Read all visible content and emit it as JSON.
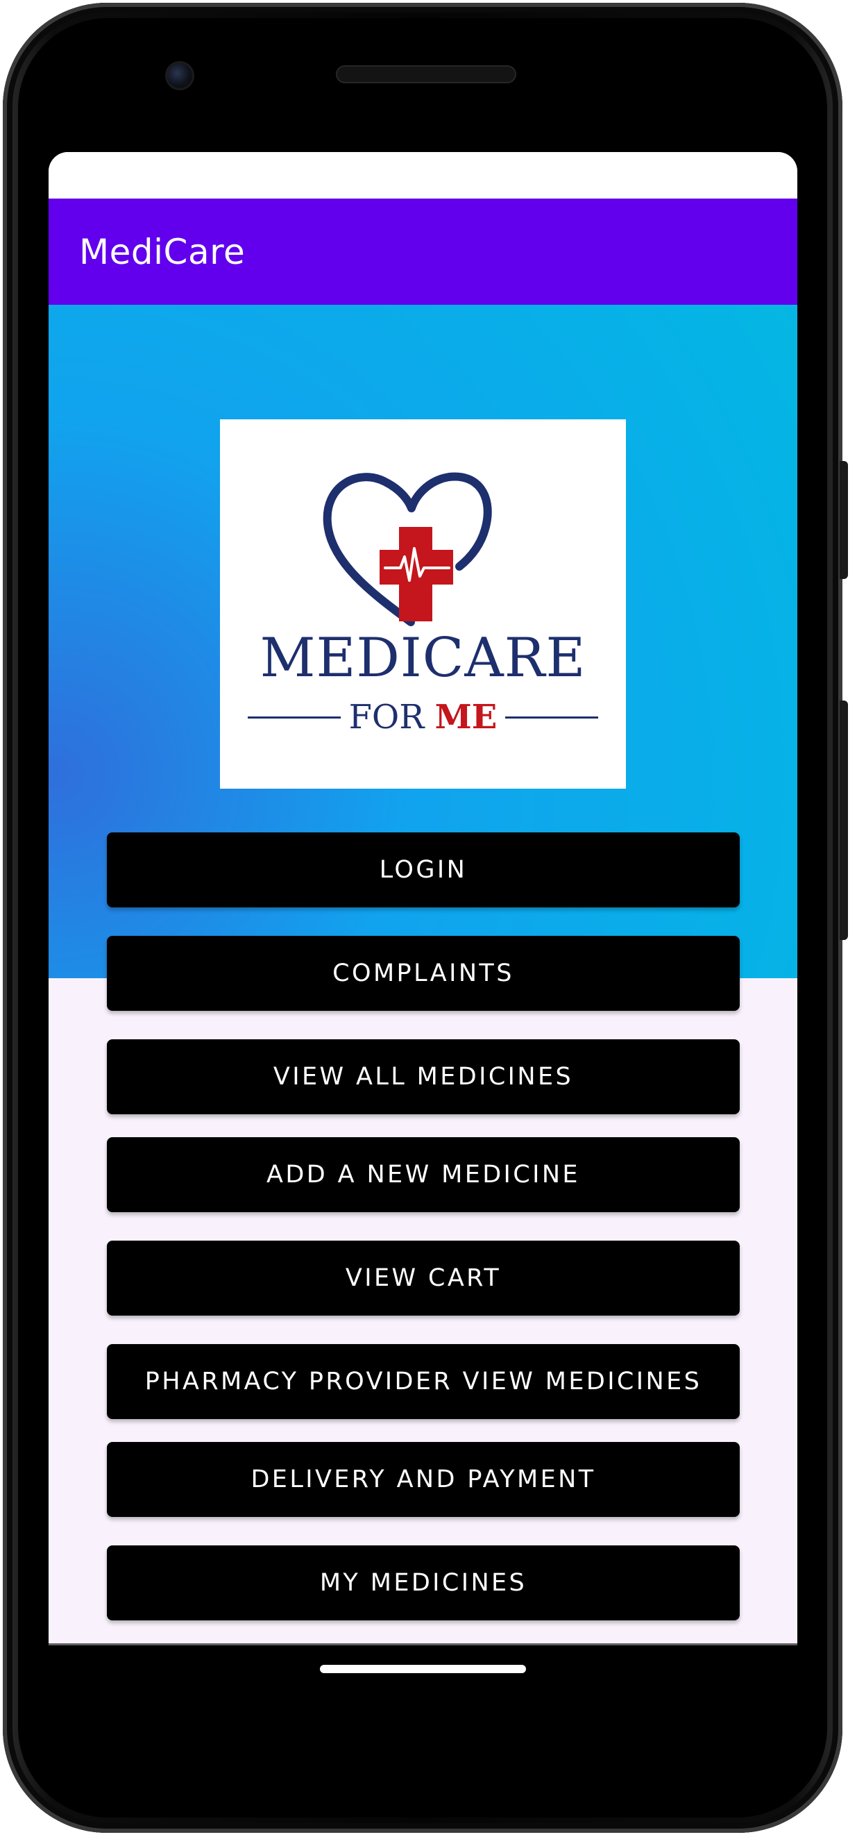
{
  "app": {
    "title": "MediCare"
  },
  "logo": {
    "main_text": "MEDICARE",
    "sub_text_for": "FOR",
    "sub_text_me": "ME",
    "colors": {
      "navy": "#1e2f6e",
      "red": "#c4161c"
    }
  },
  "menu": {
    "buttons": [
      {
        "label": "LOGIN"
      },
      {
        "label": "COMPLAINTS"
      },
      {
        "label": "VIEW ALL MEDICINES"
      },
      {
        "label": "ADD A NEW MEDICINE"
      },
      {
        "label": "VIEW CART"
      },
      {
        "label": "PHARMACY PROVIDER VIEW MEDICINES"
      },
      {
        "label": "DELIVERY AND PAYMENT"
      },
      {
        "label": "MY MEDICINES"
      }
    ]
  },
  "theme": {
    "app_bar_color": "#6200ee",
    "button_color": "#000000",
    "background_color": "#f9f2fc",
    "hero_gradient": [
      "#2f6fdc",
      "#11a3ee",
      "#07c2d6"
    ]
  }
}
